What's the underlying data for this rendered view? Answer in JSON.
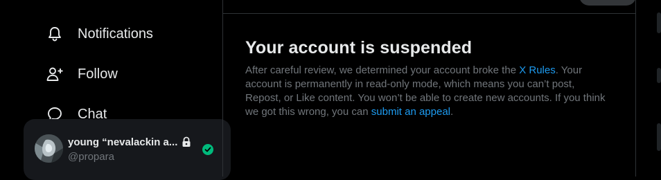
{
  "sidebar": {
    "items": [
      {
        "label": "Notifications",
        "icon": "bell-icon"
      },
      {
        "label": "Follow",
        "icon": "person-add-icon"
      },
      {
        "label": "Chat",
        "icon": "chat-bubble-icon"
      }
    ]
  },
  "account": {
    "display_name": "young “nevalackin a...",
    "handle": "@propara",
    "icons": [
      "lock-icon",
      "verified-check-icon"
    ],
    "status_color": "#00ba7c"
  },
  "main": {
    "title": "Your account is suspended",
    "message_part1": "After careful review, we determined your account broke the ",
    "rules_link": "X Rules",
    "message_part2": ". Your account is permanently in read-only mode, which means you can’t post, Repost, or Like content. You won’t be able to create new accounts. If you think we got this wrong, you can ",
    "appeal_link": "submit an appeal",
    "message_part3": "."
  },
  "colors": {
    "background": "#000000",
    "text": "#e7e9ea",
    "muted": "#71767b",
    "link": "#1d9bf0",
    "border": "#2f3336"
  }
}
